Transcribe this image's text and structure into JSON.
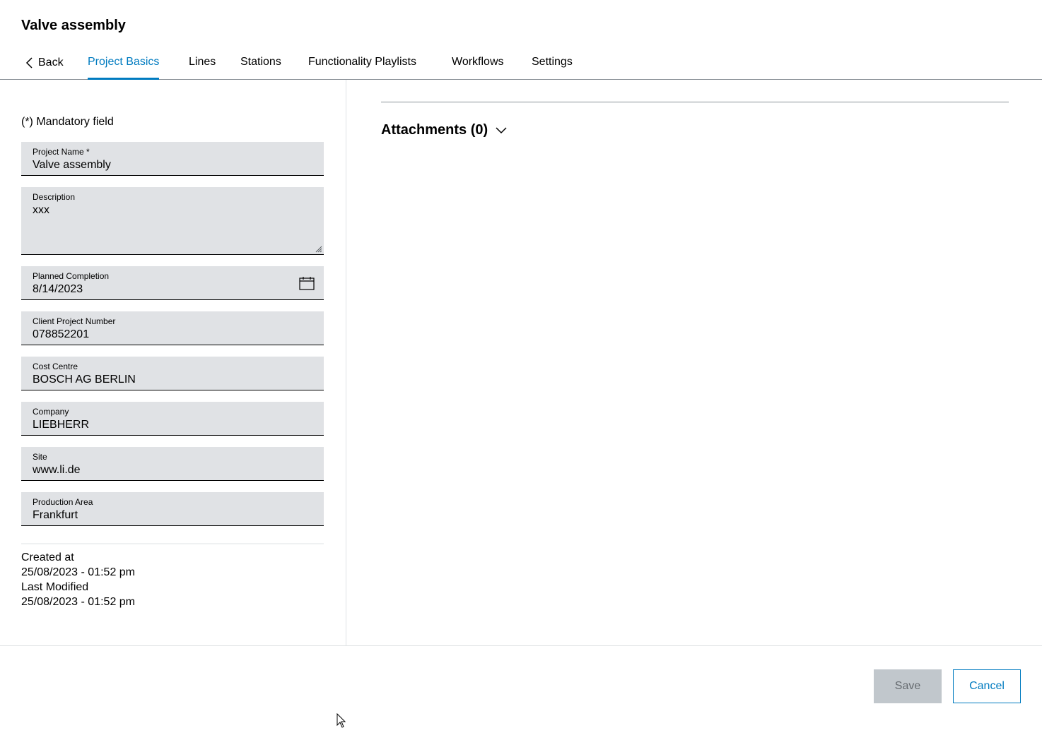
{
  "page": {
    "title": "Valve assembly"
  },
  "tabs": [
    {
      "label": "Back"
    },
    {
      "label": "Project Basics",
      "active": true
    },
    {
      "label": "Lines"
    },
    {
      "label": "Stations"
    },
    {
      "label": "Functionality Playlists"
    },
    {
      "label": "Workflows"
    },
    {
      "label": "Settings"
    }
  ],
  "form": {
    "mandatory_note": "(*) Mandatory field",
    "fields": {
      "project_name": {
        "label": "Project Name *",
        "value": "Valve assembly"
      },
      "description": {
        "label": "Description",
        "value": "xxx"
      },
      "planned_completion": {
        "label": "Planned Completion",
        "value": "8/14/2023",
        "icon": "calendar-icon"
      },
      "client_project_number": {
        "label": "Client Project Number",
        "value": "078852201"
      },
      "cost_centre": {
        "label": "Cost Centre",
        "value": "BOSCH AG BERLIN"
      },
      "company": {
        "label": "Company",
        "value": "LIEBHERR"
      },
      "site": {
        "label": "Site",
        "value": "www.li.de"
      },
      "production_area": {
        "label": "Production Area",
        "value": "Frankfurt"
      }
    }
  },
  "meta": {
    "created_label": "Created at",
    "created_value": "25/08/2023 - 01:52 pm",
    "modified_label": "Last Modified",
    "modified_value": "25/08/2023 - 01:52 pm"
  },
  "attachments": {
    "title": "Attachments (0)",
    "icon": "chevron-down-icon"
  },
  "footer": {
    "save_label": "Save",
    "cancel_label": "Cancel"
  },
  "colors": {
    "accent": "#007bc0",
    "field_background": "#e0e2e5",
    "disabled_button": "#c1c7cc"
  }
}
